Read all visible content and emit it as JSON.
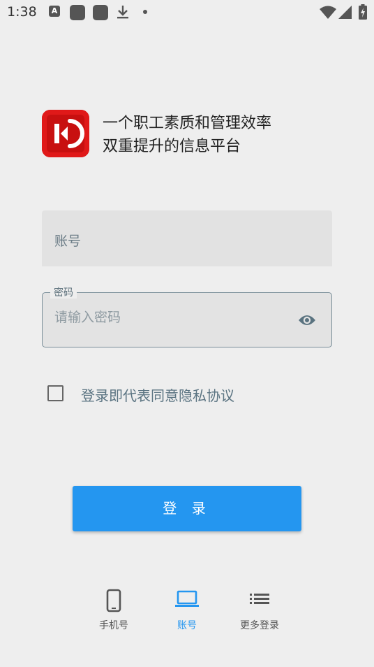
{
  "status_bar": {
    "time": "1:38",
    "a_badge": "A",
    "icons": [
      "text-a-icon",
      "app-square-icon",
      "app-square-icon",
      "download-icon",
      "dot-icon",
      "wifi-icon",
      "signal-icon",
      "battery-charging-icon"
    ]
  },
  "header": {
    "slogan_line1": "一个职工素质和管理效率",
    "slogan_line2": "双重提升的信息平台",
    "brand_color": "#e01919"
  },
  "form": {
    "account_label": "账号",
    "password_legend": "密码",
    "password_placeholder": "请输入密码",
    "password_value": ""
  },
  "agreement": {
    "text": "登录即代表同意隐私协议",
    "checked": false
  },
  "login_button": {
    "label": "登 录",
    "color": "#2496f0"
  },
  "tabs": [
    {
      "label": "手机号",
      "icon": "smartphone-icon",
      "active": false
    },
    {
      "label": "账号",
      "icon": "laptop-icon",
      "active": true
    },
    {
      "label": "更多登录",
      "icon": "list-icon",
      "active": false
    }
  ]
}
